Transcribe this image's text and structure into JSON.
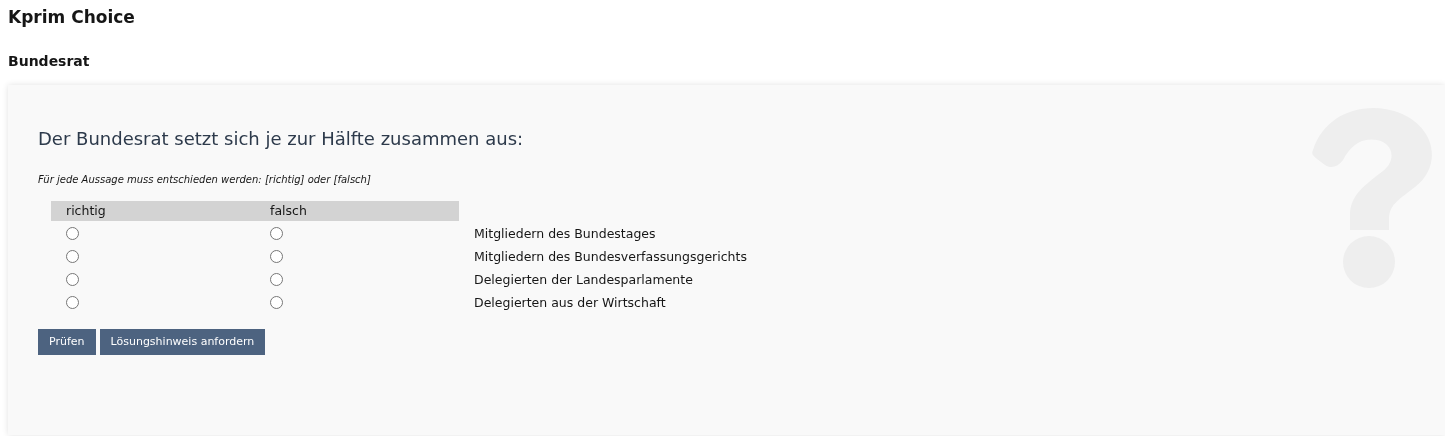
{
  "title": "Kprim Choice",
  "subtitle": "Bundesrat",
  "question": "Der Bundesrat setzt sich je zur Hälfte zusammen aus:",
  "instruction": "Für jede Aussage muss entschieden werden: [richtig] oder [falsch]",
  "columns": [
    "richtig",
    "falsch"
  ],
  "statements": [
    {
      "text": "Mitgliedern des Bundestages",
      "richtig_selected": false,
      "falsch_selected": false
    },
    {
      "text": "Mitgliedern des Bundesverfassungsgerichts",
      "richtig_selected": false,
      "falsch_selected": false
    },
    {
      "text": "Delegierten der Landesparlamente",
      "richtig_selected": false,
      "falsch_selected": false
    },
    {
      "text": "Delegierten aus der Wirtschaft",
      "richtig_selected": false,
      "falsch_selected": false
    }
  ],
  "buttons": [
    "Prüfen",
    "Lösungshinweis anfordern"
  ]
}
